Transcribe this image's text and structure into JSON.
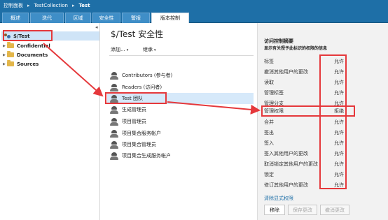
{
  "topbar": {
    "crumbs": [
      "控制面板",
      "TestCollection",
      "Test"
    ],
    "separator": "▸"
  },
  "tabs": [
    {
      "label": "概述",
      "active": false
    },
    {
      "label": "迭代",
      "active": false
    },
    {
      "label": "区域",
      "active": false
    },
    {
      "label": "安全性",
      "active": false
    },
    {
      "label": "警报",
      "active": false
    },
    {
      "label": "版本控制",
      "active": true
    }
  ],
  "sidebar": {
    "collapse_glyph": "◂",
    "items": [
      {
        "label": "$/Test",
        "icon": "repository-icon",
        "selected": true,
        "expanded": true
      },
      {
        "label": "Confidential",
        "icon": "folder-icon",
        "selected": false,
        "expanded": false
      },
      {
        "label": "Documents",
        "icon": "folder-icon",
        "selected": false,
        "expanded": false
      },
      {
        "label": "Sources",
        "icon": "folder-icon",
        "selected": false,
        "expanded": false
      }
    ]
  },
  "main": {
    "title": "$/Test 安全性",
    "add_label": "添加...",
    "inherit_label": "继承",
    "dropdown_glyph": "▾",
    "groups": [
      {
        "label": "Contributors (参与者)",
        "selected": false
      },
      {
        "label": "Readers (访问者)",
        "selected": false
      },
      {
        "label": "Test 团队",
        "selected": true
      },
      {
        "label": "生成管理员",
        "selected": false
      },
      {
        "label": "项目管理员",
        "selected": false
      },
      {
        "label": "项目集合服务帐户",
        "selected": false
      },
      {
        "label": "项目集合管理员",
        "selected": false
      },
      {
        "label": "项目集合生成服务帐户",
        "selected": false
      }
    ]
  },
  "permissions": {
    "heading": "访问控制摘要",
    "subheading": "显示有关授予此标识的权限的信息",
    "rows": [
      {
        "name": "标签",
        "value": "允许"
      },
      {
        "name": "撤消其他用户的更改",
        "value": "允许"
      },
      {
        "name": "读取",
        "value": "允许"
      },
      {
        "name": "管理标签",
        "value": "允许"
      },
      {
        "name": "管理分支",
        "value": "允许"
      },
      {
        "name": "管理权限",
        "value": "拒绝"
      },
      {
        "name": "合并",
        "value": "允许"
      },
      {
        "name": "签出",
        "value": "允许"
      },
      {
        "name": "签入",
        "value": "允许"
      },
      {
        "name": "签入其他用户的更改",
        "value": "允许"
      },
      {
        "name": "取消锁定其他用户的更改",
        "value": "允许"
      },
      {
        "name": "锁定",
        "value": "允许"
      },
      {
        "name": "修订其他用户的更改",
        "value": "允许"
      }
    ],
    "clear_link": "清除显式权限",
    "buttons": {
      "remove": "移除",
      "save": "保存更改",
      "undo": "撤消更改"
    }
  },
  "colors": {
    "header": "#1e6fa7",
    "annotation": "#e5383b",
    "selection": "#d6e9fa"
  }
}
